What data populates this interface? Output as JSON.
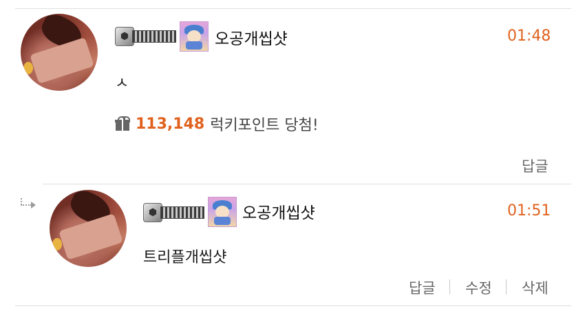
{
  "comments": [
    {
      "nickname": "오공개씹샷",
      "time": "01:48",
      "content": "ㅅ",
      "lucky_points": "113,148",
      "lucky_text": "럭키포인트 당첨!",
      "actions": {
        "reply": "답글"
      }
    },
    {
      "nickname": "오공개씹샷",
      "time": "01:51",
      "content": "트리플개씹샷",
      "actions": {
        "reply": "답글",
        "edit": "수정",
        "delete": "삭제"
      }
    }
  ],
  "colors": {
    "accent": "#e0611d",
    "divider": "#dedede",
    "action_text": "#666666"
  },
  "icons": {
    "gift": "gift-icon",
    "reply_arrow": "reply-arrow-icon"
  }
}
